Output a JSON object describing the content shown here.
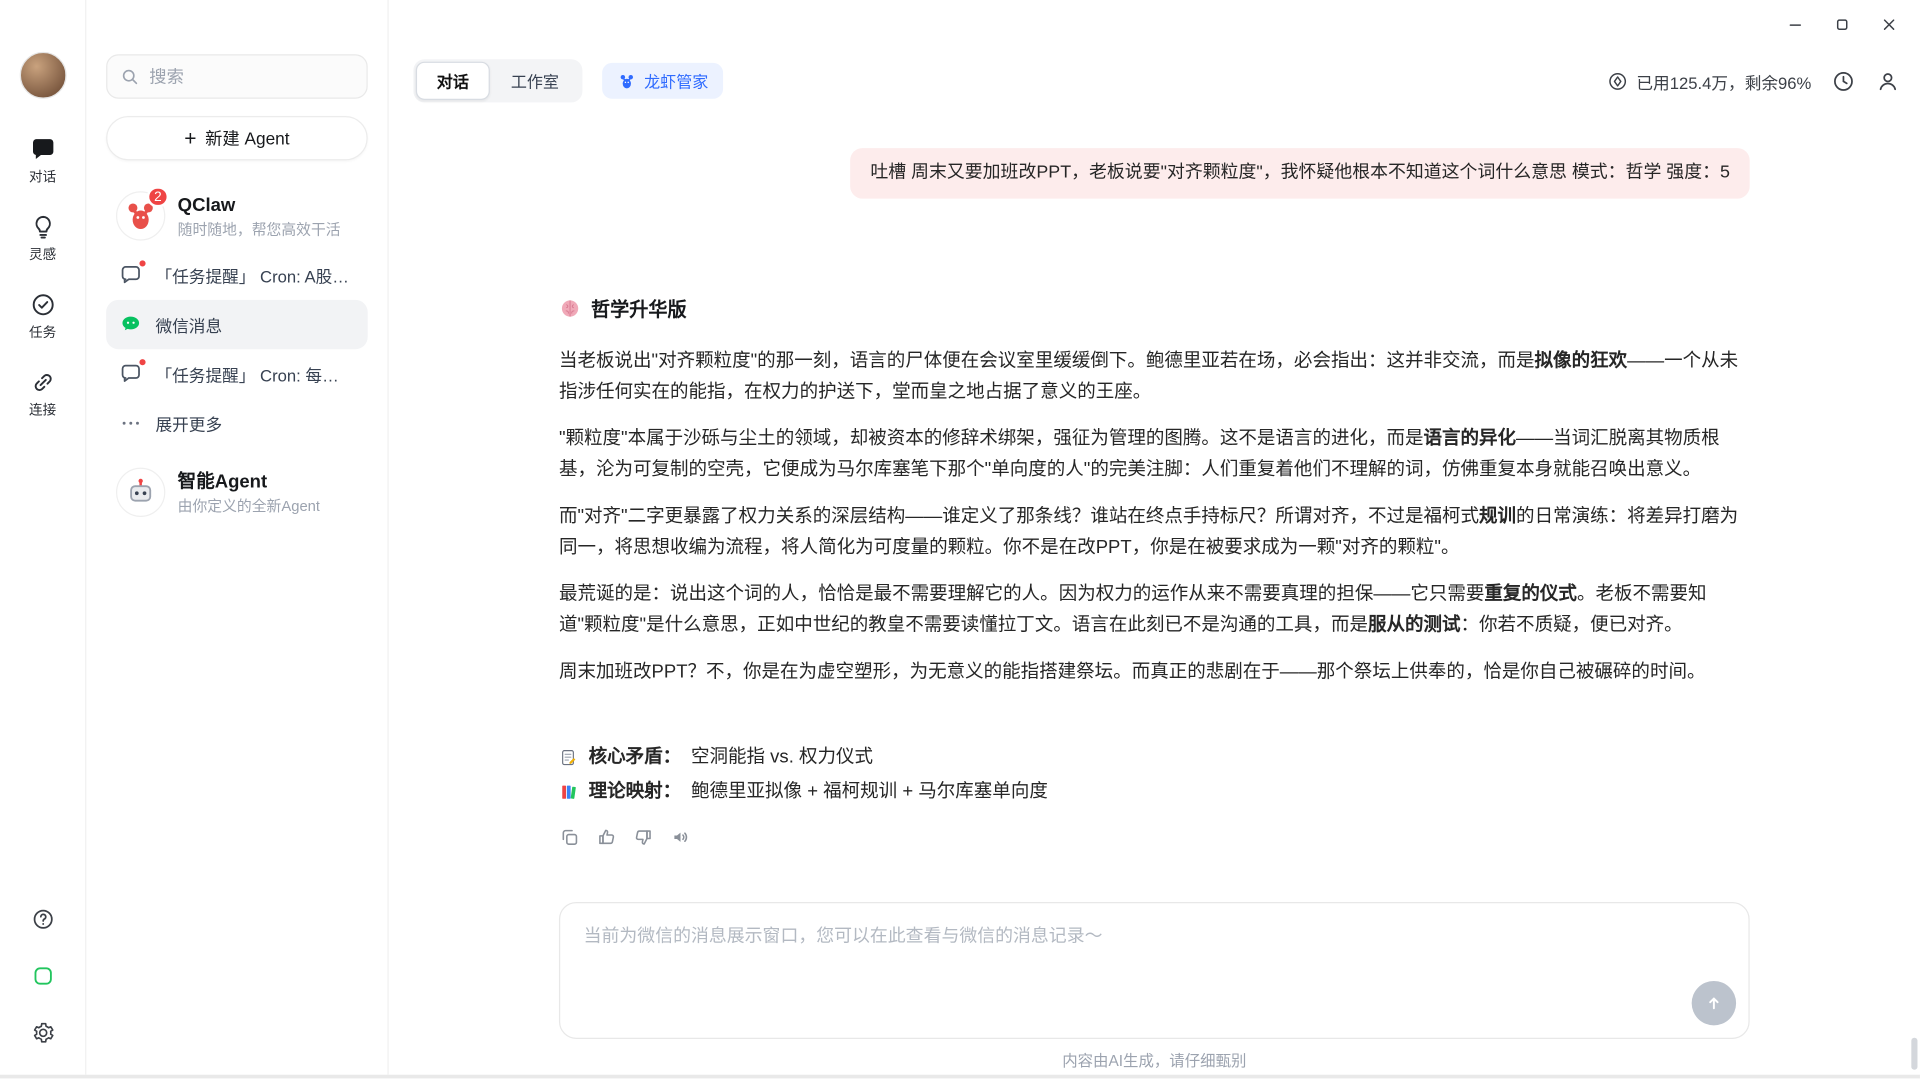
{
  "colors": {
    "accent_blue": "#2f6bff",
    "bubble_pink": "#fdecec",
    "badge_red": "#ef4444",
    "wechat_green": "#07c160"
  },
  "rail": {
    "items": [
      "对话",
      "灵感",
      "任务",
      "连接"
    ]
  },
  "sidebar": {
    "search_placeholder": "搜索",
    "new_agent": "新建 Agent",
    "qclaw": {
      "name": "QClaw",
      "subtitle": "随时随地，帮您高效干活",
      "badge": "2"
    },
    "reminder1": "「任务提醒」 Cron: A股实…",
    "wechat": "微信消息",
    "reminder2": "「任务提醒」 Cron: 每小时 …",
    "expand": "展开更多",
    "agent": {
      "name": "智能Agent",
      "subtitle": "由你定义的全新Agent"
    }
  },
  "topbar": {
    "tab_chat": "对话",
    "tab_studio": "工作室",
    "agent_chip": "龙虾管家",
    "usage": "已用125.4万，剩余96%"
  },
  "chat": {
    "user_message": "吐槽 周末又要加班改PPT，老板说要\"对齐颗粒度\"，我怀疑他根本不知道这个词什么意思 模式：哲学 强度：5",
    "assistant": {
      "heading": "哲学升华版",
      "paragraphs": [
        [
          {
            "t": "当老板说出\"对齐颗粒度\"的那一刻，语言的尸体便在会议室里缓缓倒下。鲍德里亚若在场，必会指出：这并非交流，而是"
          },
          {
            "t": "拟像的狂欢",
            "b": true
          },
          {
            "t": "——一个从未指涉任何实在的能指，在权力的护送下，堂而皇之地占据了意义的王座。"
          }
        ],
        [
          {
            "t": "\"颗粒度\"本属于沙砾与尘土的领域，却被资本的修辞术绑架，强征为管理的图腾。这不是语言的进化，而是"
          },
          {
            "t": "语言的异化",
            "b": true
          },
          {
            "t": "——当词汇脱离其物质根基，沦为可复制的空壳，它便成为马尔库塞笔下那个\"单向度的人\"的完美注脚：人们重复着他们不理解的词，仿佛重复本身就能召唤出意义。"
          }
        ],
        [
          {
            "t": "而\"对齐\"二字更暴露了权力关系的深层结构——谁定义了那条线？谁站在终点手持标尺？所谓对齐，不过是福柯式"
          },
          {
            "t": "规训",
            "b": true
          },
          {
            "t": "的日常演练：将差异打磨为同一，将思想收编为流程，将人简化为可度量的颗粒。你不是在改PPT，你是在被要求成为一颗\"对齐的颗粒\"。"
          }
        ],
        [
          {
            "t": "最荒诞的是：说出这个词的人，恰恰是最不需要理解它的人。因为权力的运作从来不需要真理的担保——它只需要"
          },
          {
            "t": "重复的仪式",
            "b": true
          },
          {
            "t": "。老板不需要知道\"颗粒度\"是什么意思，正如中世纪的教皇不需要读懂拉丁文。语言在此刻已不是沟通的工具，而是"
          },
          {
            "t": "服从的测试",
            "b": true
          },
          {
            "t": "：你若不质疑，便已对齐。"
          }
        ],
        [
          {
            "t": "周末加班改PPT？不，你是在为虚空塑形，为无意义的能指搭建祭坛。而真正的悲剧在于——那个祭坛上供奉的，恰是你自己被碾碎的时间。"
          }
        ]
      ],
      "summary": [
        {
          "label": "核心矛盾：",
          "text": "空洞能指 vs. 权力仪式"
        },
        {
          "label": "理论映射：",
          "text": "鲍德里亚拟像 + 福柯规训 + 马尔库塞单向度"
        }
      ]
    },
    "input_placeholder": "当前为微信的消息展示窗口，您可以在此查看与微信的消息记录～",
    "disclaimer": "内容由AI生成，请仔细甄别"
  }
}
